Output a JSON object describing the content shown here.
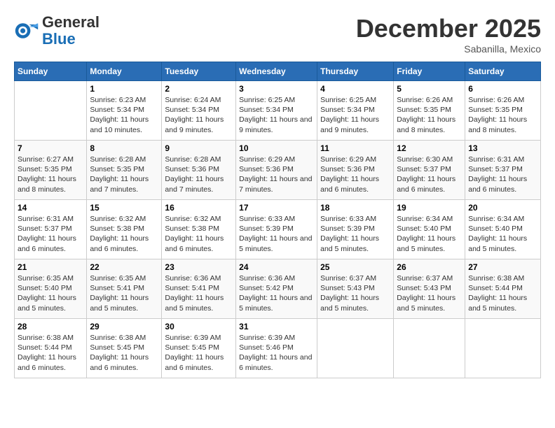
{
  "logo": {
    "general": "General",
    "blue": "Blue"
  },
  "title": "December 2025",
  "subtitle": "Sabanilla, Mexico",
  "days_header": [
    "Sunday",
    "Monday",
    "Tuesday",
    "Wednesday",
    "Thursday",
    "Friday",
    "Saturday"
  ],
  "weeks": [
    [
      {
        "num": "",
        "info": ""
      },
      {
        "num": "1",
        "info": "Sunrise: 6:23 AM\nSunset: 5:34 PM\nDaylight: 11 hours and 10 minutes."
      },
      {
        "num": "2",
        "info": "Sunrise: 6:24 AM\nSunset: 5:34 PM\nDaylight: 11 hours and 9 minutes."
      },
      {
        "num": "3",
        "info": "Sunrise: 6:25 AM\nSunset: 5:34 PM\nDaylight: 11 hours and 9 minutes."
      },
      {
        "num": "4",
        "info": "Sunrise: 6:25 AM\nSunset: 5:34 PM\nDaylight: 11 hours and 9 minutes."
      },
      {
        "num": "5",
        "info": "Sunrise: 6:26 AM\nSunset: 5:35 PM\nDaylight: 11 hours and 8 minutes."
      },
      {
        "num": "6",
        "info": "Sunrise: 6:26 AM\nSunset: 5:35 PM\nDaylight: 11 hours and 8 minutes."
      }
    ],
    [
      {
        "num": "7",
        "info": "Sunrise: 6:27 AM\nSunset: 5:35 PM\nDaylight: 11 hours and 8 minutes."
      },
      {
        "num": "8",
        "info": "Sunrise: 6:28 AM\nSunset: 5:35 PM\nDaylight: 11 hours and 7 minutes."
      },
      {
        "num": "9",
        "info": "Sunrise: 6:28 AM\nSunset: 5:36 PM\nDaylight: 11 hours and 7 minutes."
      },
      {
        "num": "10",
        "info": "Sunrise: 6:29 AM\nSunset: 5:36 PM\nDaylight: 11 hours and 7 minutes."
      },
      {
        "num": "11",
        "info": "Sunrise: 6:29 AM\nSunset: 5:36 PM\nDaylight: 11 hours and 6 minutes."
      },
      {
        "num": "12",
        "info": "Sunrise: 6:30 AM\nSunset: 5:37 PM\nDaylight: 11 hours and 6 minutes."
      },
      {
        "num": "13",
        "info": "Sunrise: 6:31 AM\nSunset: 5:37 PM\nDaylight: 11 hours and 6 minutes."
      }
    ],
    [
      {
        "num": "14",
        "info": "Sunrise: 6:31 AM\nSunset: 5:37 PM\nDaylight: 11 hours and 6 minutes."
      },
      {
        "num": "15",
        "info": "Sunrise: 6:32 AM\nSunset: 5:38 PM\nDaylight: 11 hours and 6 minutes."
      },
      {
        "num": "16",
        "info": "Sunrise: 6:32 AM\nSunset: 5:38 PM\nDaylight: 11 hours and 6 minutes."
      },
      {
        "num": "17",
        "info": "Sunrise: 6:33 AM\nSunset: 5:39 PM\nDaylight: 11 hours and 5 minutes."
      },
      {
        "num": "18",
        "info": "Sunrise: 6:33 AM\nSunset: 5:39 PM\nDaylight: 11 hours and 5 minutes."
      },
      {
        "num": "19",
        "info": "Sunrise: 6:34 AM\nSunset: 5:40 PM\nDaylight: 11 hours and 5 minutes."
      },
      {
        "num": "20",
        "info": "Sunrise: 6:34 AM\nSunset: 5:40 PM\nDaylight: 11 hours and 5 minutes."
      }
    ],
    [
      {
        "num": "21",
        "info": "Sunrise: 6:35 AM\nSunset: 5:40 PM\nDaylight: 11 hours and 5 minutes."
      },
      {
        "num": "22",
        "info": "Sunrise: 6:35 AM\nSunset: 5:41 PM\nDaylight: 11 hours and 5 minutes."
      },
      {
        "num": "23",
        "info": "Sunrise: 6:36 AM\nSunset: 5:41 PM\nDaylight: 11 hours and 5 minutes."
      },
      {
        "num": "24",
        "info": "Sunrise: 6:36 AM\nSunset: 5:42 PM\nDaylight: 11 hours and 5 minutes."
      },
      {
        "num": "25",
        "info": "Sunrise: 6:37 AM\nSunset: 5:43 PM\nDaylight: 11 hours and 5 minutes."
      },
      {
        "num": "26",
        "info": "Sunrise: 6:37 AM\nSunset: 5:43 PM\nDaylight: 11 hours and 5 minutes."
      },
      {
        "num": "27",
        "info": "Sunrise: 6:38 AM\nSunset: 5:44 PM\nDaylight: 11 hours and 5 minutes."
      }
    ],
    [
      {
        "num": "28",
        "info": "Sunrise: 6:38 AM\nSunset: 5:44 PM\nDaylight: 11 hours and 6 minutes."
      },
      {
        "num": "29",
        "info": "Sunrise: 6:38 AM\nSunset: 5:45 PM\nDaylight: 11 hours and 6 minutes."
      },
      {
        "num": "30",
        "info": "Sunrise: 6:39 AM\nSunset: 5:45 PM\nDaylight: 11 hours and 6 minutes."
      },
      {
        "num": "31",
        "info": "Sunrise: 6:39 AM\nSunset: 5:46 PM\nDaylight: 11 hours and 6 minutes."
      },
      {
        "num": "",
        "info": ""
      },
      {
        "num": "",
        "info": ""
      },
      {
        "num": "",
        "info": ""
      }
    ]
  ]
}
